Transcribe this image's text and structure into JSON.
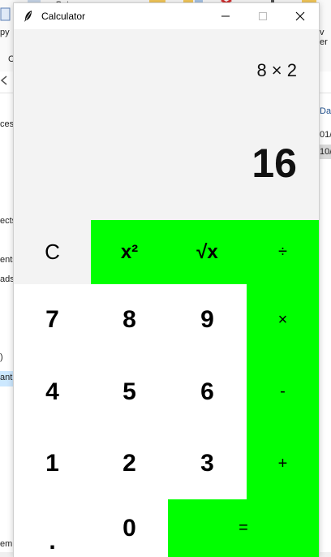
{
  "background": {
    "ribbon_items": [
      "py",
      "Cut",
      "C"
    ],
    "right_items": [
      "v",
      "er"
    ],
    "nav_items": [
      "cess",
      "ects",
      "ents",
      "ads",
      ")",
      "ant"
    ],
    "right_column": [
      "Da",
      "01/",
      "10/"
    ],
    "bottom_left": "em s"
  },
  "window": {
    "title": "Calculator",
    "minimize_symbol": "—",
    "maximize_symbol": "☐",
    "close_symbol": "✕"
  },
  "display": {
    "expression": "8 × 2",
    "result": "16"
  },
  "keys": {
    "clear": "C",
    "square": "x²",
    "sqrt": "√x",
    "divide": "÷",
    "seven": "7",
    "eight": "8",
    "nine": "9",
    "multiply": "×",
    "four": "4",
    "five": "5",
    "six": "6",
    "minus": "-",
    "one": "1",
    "two": "2",
    "three": "3",
    "plus": "+",
    "decimal": ".",
    "zero": "0",
    "equals": "="
  },
  "colors": {
    "accent_green": "#00ff00",
    "display_bg": "#f3f3f3",
    "digit_bg": "#ffffff"
  }
}
